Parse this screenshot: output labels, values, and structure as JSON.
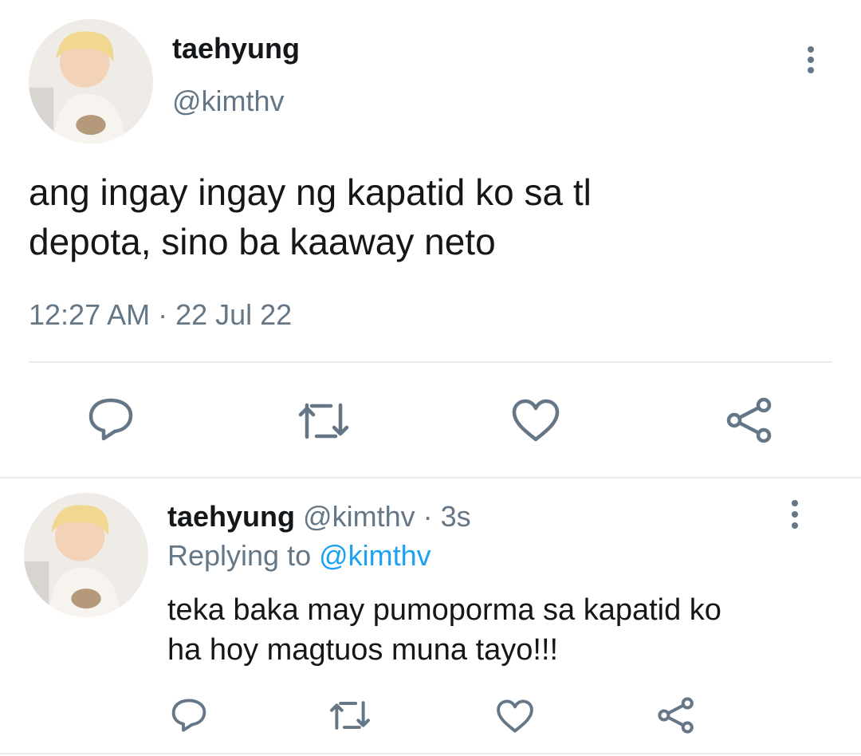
{
  "main_tweet": {
    "display_name": "taehyung",
    "handle": "@kimthv",
    "text_line1": "ang ingay ingay ng kapatid ko sa tl",
    "text_line2": "depota, sino ba kaaway neto",
    "timestamp": "12:27 AM · 22 Jul 22",
    "more_icon": "vertical-dots-icon"
  },
  "reply_tweet": {
    "display_name": "taehyung",
    "handle": "@kimthv",
    "separator": "·",
    "time_ago": "3s",
    "replying_prefix": "Replying to",
    "replying_handle": "@kimthv",
    "text_line1": "teka baka may pumoporma sa kapatid ko",
    "text_line2": "ha hoy magtuos muna tayo!!!",
    "more_icon": "vertical-dots-icon"
  },
  "actions": [
    "reply-icon",
    "retweet-icon",
    "like-icon",
    "share-icon"
  ],
  "colors": {
    "text": "#14171a",
    "secondary": "#657786",
    "link": "#1da1f2",
    "divider": "#e6ecf0"
  }
}
